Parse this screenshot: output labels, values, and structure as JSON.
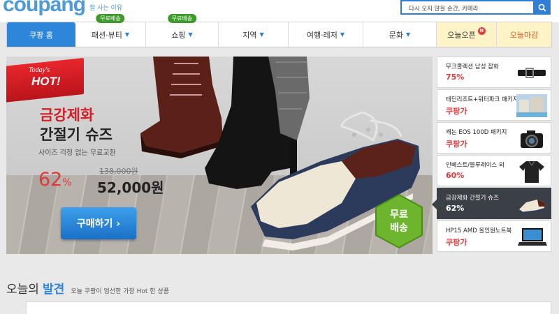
{
  "header": {
    "logo": "coupang",
    "tagline": "잘 사는 이유",
    "search_placeholder": "다시 오지 않을 순간, 카메라"
  },
  "nav": {
    "items": [
      {
        "label": "쿠팡 홈",
        "caret": false,
        "pill": ""
      },
      {
        "label": "패션·뷰티",
        "caret": true,
        "pill": "무료배송"
      },
      {
        "label": "쇼핑",
        "caret": true,
        "pill": "무료배송"
      },
      {
        "label": "지역",
        "caret": true,
        "pill": ""
      },
      {
        "label": "여행·레저",
        "caret": true,
        "pill": ""
      },
      {
        "label": "문화",
        "caret": true,
        "pill": ""
      },
      {
        "label": "오늘오픈",
        "caret": false,
        "pill": "",
        "badge": "N"
      },
      {
        "label": "오늘마감",
        "caret": false,
        "pill": ""
      }
    ]
  },
  "hero": {
    "today": "Today's",
    "hot": "HOT!",
    "title_line1": "금강제화",
    "title_line2": "간절기 슈즈",
    "subtitle": "사이즈 걱정 없는 무료교환",
    "discount_value": "62",
    "discount_unit": "%",
    "original_price": "138,000원",
    "sale_price": "52,000원",
    "buy_button": "구매하기 ›",
    "free_shipping_line1": "무료",
    "free_shipping_line2": "배송"
  },
  "side_deals": [
    {
      "name": "무크콜렉션 남성 잡화",
      "value": "75%",
      "icon": "belt-icon"
    },
    {
      "name": "테딘리조트+워터파크 패키지",
      "value": "쿠팡가",
      "icon": "resort-icon"
    },
    {
      "name": "캐논 EOS 100D 패키지",
      "value": "쿠팡가",
      "icon": "camera-icon"
    },
    {
      "name": "인베스트/블루레이스 외",
      "value": "60%",
      "icon": "blouse-icon"
    },
    {
      "name": "금강제화 간절기 슈즈",
      "value": "62%",
      "icon": "shoe-icon",
      "selected": true
    },
    {
      "name": "HP15 AMD 올인원노트북",
      "value": "쿠팡가",
      "icon": "laptop-icon"
    }
  ],
  "discovery": {
    "title_part1": "오늘의",
    "title_part2": "발견",
    "subtitle": "오늘 쿠팡이 엄선한 가장 Hot 한 상품"
  },
  "colors": {
    "brand_blue": "#2e86da",
    "accent_red": "#e23a3a",
    "free_ship_green": "#3f9a2c"
  }
}
